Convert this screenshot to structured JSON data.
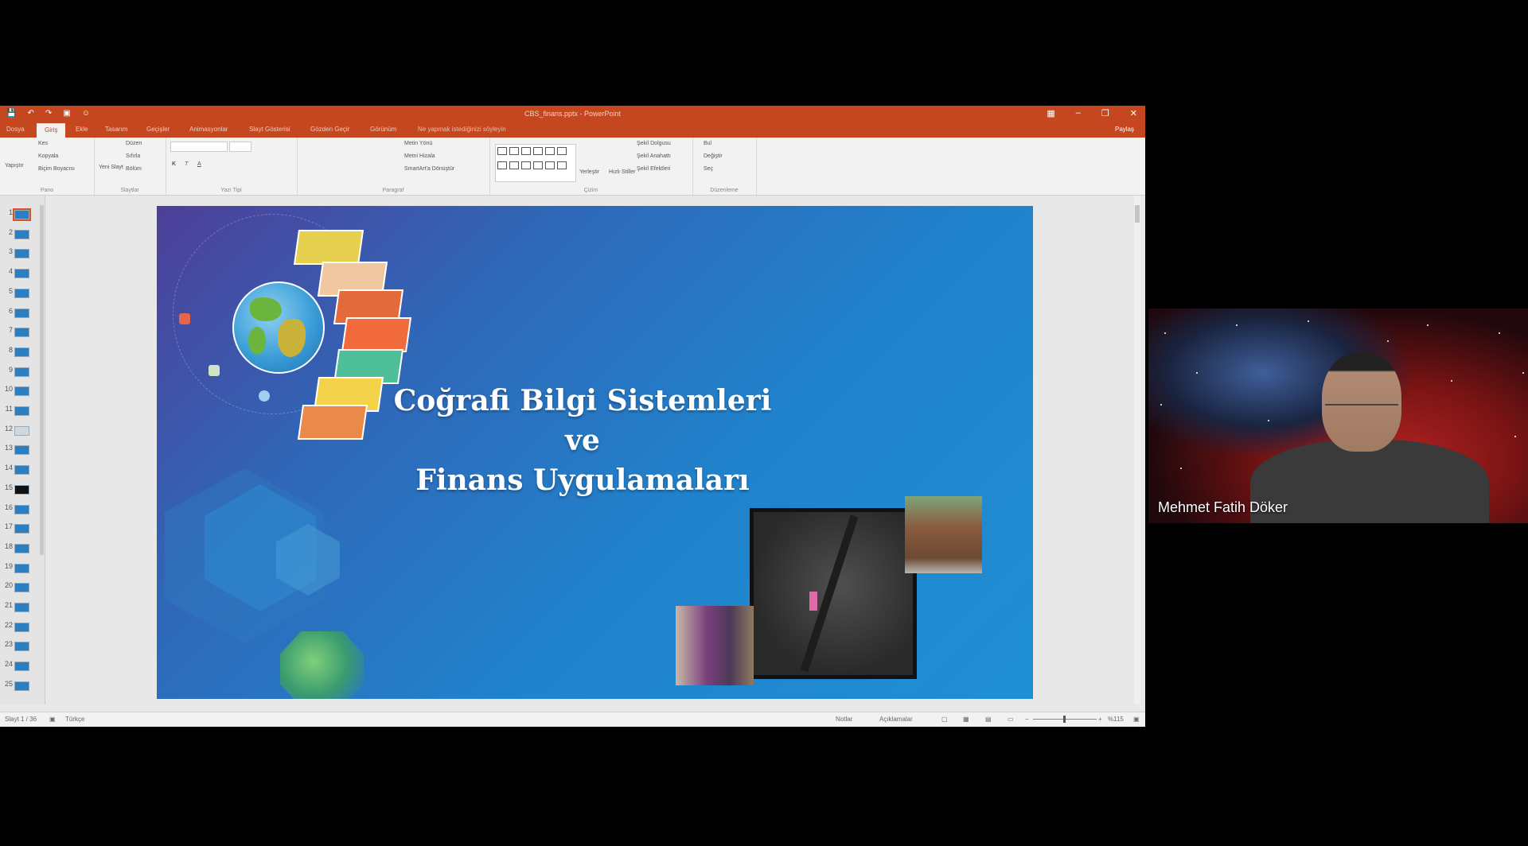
{
  "window": {
    "title": "CBS_finans.pptx - PowerPoint"
  },
  "tabs": [
    "Dosya",
    "Giriş",
    "Ekle",
    "Tasarım",
    "Geçişler",
    "Animasyonlar",
    "Slayt Gösterisi",
    "Gözden Geçir",
    "Görünüm"
  ],
  "tell_me": "Ne yapmak istediğinizi söyleyin",
  "share_label": "Paylaş",
  "ribbon": {
    "groups": [
      "Pano",
      "Slaytlar",
      "Yazı Tipi",
      "Paragraf",
      "Çizim",
      "Düzenleme"
    ],
    "clipboard_items": [
      "Kes",
      "Kopyala",
      "Biçim Boyacısı"
    ],
    "slides_items": [
      "Düzen",
      "Sıfırla",
      "Bölüm"
    ],
    "new_slide": "Yeni Slayt",
    "paste": "Yapıştır",
    "paragraph_items": [
      "Metin Yönü",
      "Metni Hizala",
      "SmartArt'a Dönüştür"
    ],
    "drawing_items": [
      "Şekil Dolgusu",
      "Şekil Anahattı",
      "Şekil Efektleri"
    ],
    "arrange": "Yerleştir",
    "quick_styles": "Hızlı Stiller",
    "edit_items": [
      "Bul",
      "Değiştir",
      "Seç"
    ]
  },
  "thumbnails": [
    "1",
    "2",
    "3",
    "4",
    "5",
    "6",
    "7",
    "8",
    "9",
    "10",
    "11",
    "12",
    "13",
    "14",
    "15",
    "16",
    "17",
    "18",
    "19",
    "20",
    "21",
    "22",
    "23",
    "24",
    "25"
  ],
  "slide": {
    "title_line1": "Coğrafi Bilgi Sistemleri",
    "title_line2": "ve",
    "title_line3": "Finans Uygulamaları"
  },
  "status": {
    "slide_count": "Slayt 1 / 36",
    "language": "Türkçe",
    "notes": "Notlar",
    "comments": "Açıklamalar",
    "zoom": "%115"
  },
  "video": {
    "participant_name": "Mehmet Fatih Döker"
  },
  "colors": {
    "ribbon_accent": "#c4471f",
    "slide_blue": "#1f8fd3"
  }
}
